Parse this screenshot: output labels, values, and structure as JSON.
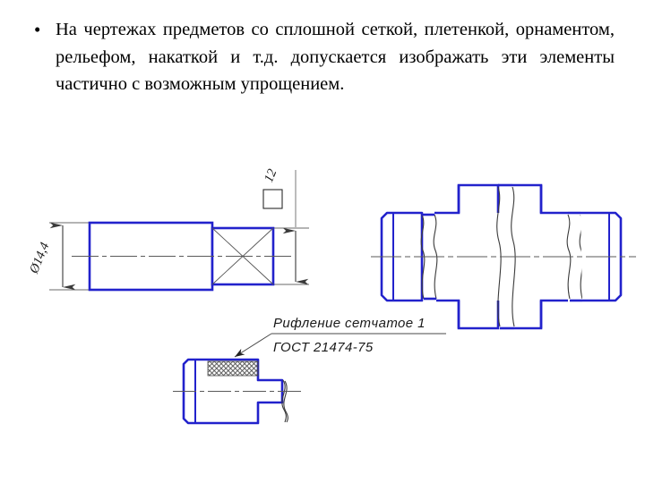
{
  "slide": {
    "bullet_marker": "•",
    "body_text": "На чертежах предметов со сплошной сеткой, плетенкой, орнаментом, рельефом, накаткой и т.д. допускается изображать эти элементы частично с возможным упрощением.",
    "background_color": "#ffffff",
    "text_color": "#000000"
  },
  "drawings": {
    "line_color_outline": "#2222cc",
    "line_color_thin": "#555555",
    "line_color_text": "#1a1a1a",
    "figure_left": {
      "name": "knurled-square-end-shaft",
      "dimension_diameter_label": "Ø14,4",
      "dimension_square_label": "12",
      "square_symbol": "□",
      "description": "Вид вала с квадратным концом, обозначенным диагоналями"
    },
    "figure_right": {
      "name": "stepped-shaft-with-breaks",
      "description": "Ступенчатый вал с частичным изображением элементов (линии обрыва)"
    },
    "figure_bottom": {
      "name": "knurled-part-with-callout",
      "callout_line_1": "Рифление сетчатое 1",
      "callout_line_2": "ГОСТ 21474-75",
      "knurl_pattern": "сетчатое"
    }
  }
}
